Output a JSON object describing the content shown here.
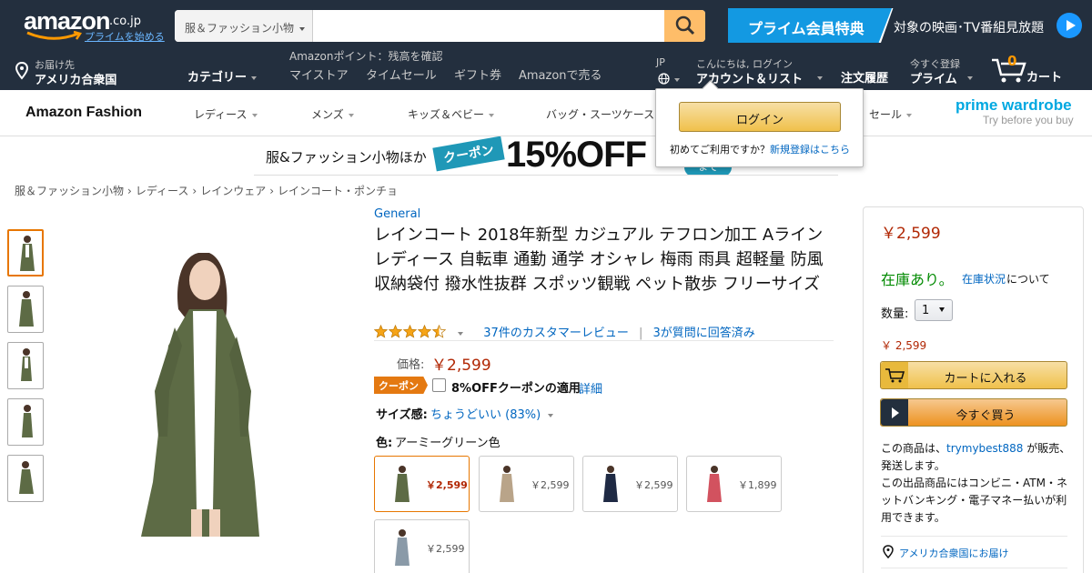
{
  "nav": {
    "logo_text": "amazon",
    "logo_suffix": ".co.jp",
    "prime_start_link": "プライムを始める",
    "search_category": "服＆ファッション小物",
    "search_placeholder": "",
    "prime_banner_left": "プライム会員特典",
    "prime_banner_right": "対象の映画･TV番組見放題",
    "deliver_label": "お届け先",
    "deliver_location": "アメリカ合衆国",
    "category_label": "カテゴリー",
    "points_text": "Amazonポイント：残高を確認",
    "links": [
      "マイストア",
      "タイムセール",
      "ギフト券",
      "Amazonで売る"
    ],
    "lang_top": "JP",
    "greeting": "こんにちは, ログイン",
    "account_list": "アカウント＆リスト",
    "order_history": "注文履歴",
    "prime_top": "今すぐ登録",
    "prime_bottom": "プライム",
    "cart_count": "0",
    "cart_label": "カート"
  },
  "fashion_bar": {
    "title": "Amazon Fashion",
    "items": [
      "レディース",
      "メンズ",
      "キッズ＆ベビー",
      "バッグ・スーツケース",
      "セール"
    ],
    "prime_wardrobe": "prime wardrobe",
    "prime_wardrobe_tag": "Try before you buy"
  },
  "promo": {
    "lead": "服&ファッション小物ほか",
    "coupon_tag": "クーポン",
    "discount": "15%OFF",
    "tail_tag": "まで"
  },
  "popover": {
    "login_button": "ログイン",
    "first_time": "初めてご利用ですか？",
    "register_link": "新規登録はこちら"
  },
  "breadcrumb": [
    "服＆ファッション小物",
    "レディース",
    "レインウェア",
    "レインコート・ポンチョ"
  ],
  "product": {
    "brand": "General",
    "title": "レインコート 2018年新型 カジュアル テフロン加工 Aライン レディース 自転車 通勤 通学 オシャレ 梅雨 雨具 超軽量 防風 収納袋付 撥水性抜群 スポッツ観戦 ペット散歩 フリーサイズ",
    "rating": 4.5,
    "reviews_link": "37件のカスタマーレビュー",
    "qa_link": "3が質問に回答済み",
    "price_label": "価格:",
    "price": "￥2,599",
    "coupon_badge": "クーポン",
    "coupon_text": "8%OFFクーポンの適用",
    "coupon_detail": "詳細",
    "size_label": "サイズ感:",
    "size_value": "ちょうどいい (83%)",
    "color_label": "色:",
    "color_value": "アーミーグリーン色",
    "swatches": [
      {
        "price": "￥2,599",
        "color": "#5d6b45"
      },
      {
        "price": "￥2,599",
        "color": "#b9a489"
      },
      {
        "price": "￥2,599",
        "color": "#1f2a44"
      },
      {
        "price": "￥1,899",
        "color": "#d2525f"
      },
      {
        "price": "￥2,599",
        "color": "#8a9aa8"
      }
    ]
  },
  "buybox": {
    "price": "￥2,599",
    "stock": "在庫あり。",
    "stock_link": "在庫状況",
    "stock_tail": "について",
    "qty_label": "数量:",
    "qty_value": "1",
    "price_small": "￥ 2,599",
    "add_to_cart": "カートに入れる",
    "buy_now": "今すぐ買う",
    "seller_pre": "この商品は、",
    "seller": "trymybest888",
    "seller_post": "が販売、発送します。",
    "payment_note": "この出品商品にはコンビニ・ATM・ネットバンキング・電子マネー払いが利用できます。",
    "deliver_link": "アメリカ合衆国にお届け"
  }
}
